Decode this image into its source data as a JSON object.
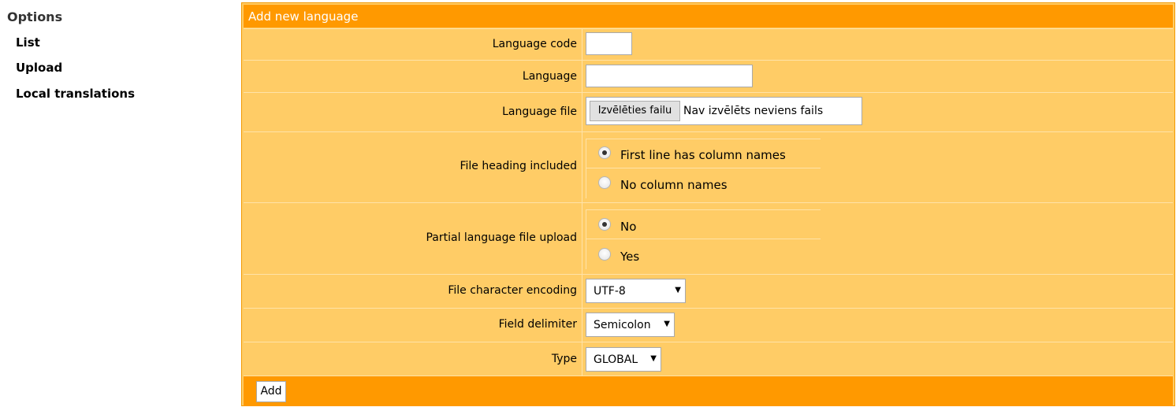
{
  "sidebar": {
    "title": "Options",
    "links": [
      "List",
      "Upload",
      "Local translations"
    ]
  },
  "form": {
    "heading": "Add new language",
    "language_code": {
      "label": "Language code",
      "value": ""
    },
    "language": {
      "label": "Language",
      "value": ""
    },
    "language_file": {
      "label": "Language file",
      "button": "Izvēlēties failu",
      "status": "Nav izvēlēts neviens fails"
    },
    "file_heading": {
      "label": "File heading included",
      "options": [
        "First line has column names",
        "No column names"
      ],
      "selected": "First line has column names"
    },
    "partial_upload": {
      "label": "Partial language file upload",
      "options": [
        "No",
        "Yes"
      ],
      "selected": "No"
    },
    "encoding": {
      "label": "File character encoding",
      "value": "UTF-8"
    },
    "delimiter": {
      "label": "Field delimiter",
      "value": "Semicolon"
    },
    "type": {
      "label": "Type",
      "value": "GLOBAL"
    },
    "submit_label": "Add"
  },
  "colors": {
    "header": "#ff9900",
    "panel": "#ffcc66",
    "border": "#ffe3a8"
  }
}
